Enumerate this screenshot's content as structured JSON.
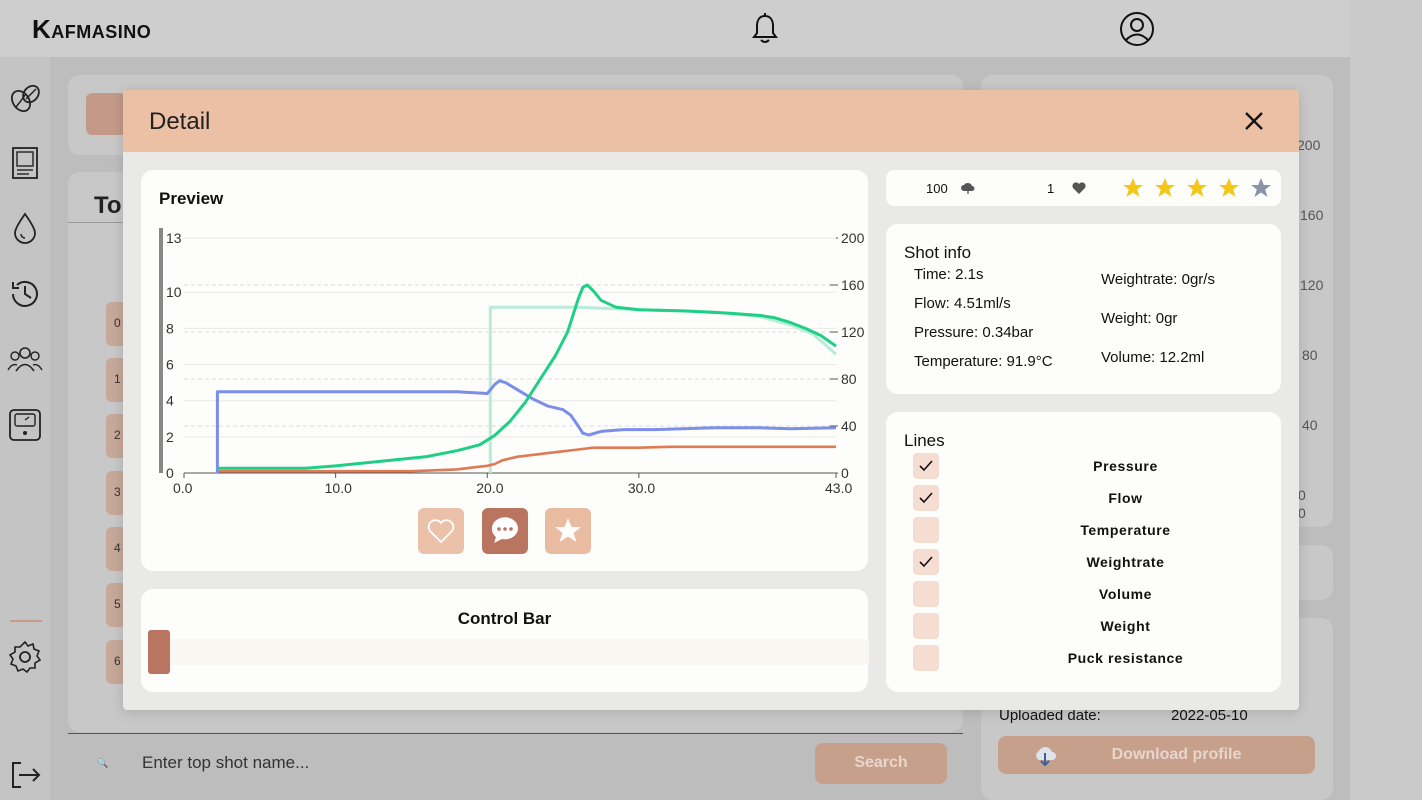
{
  "app": {
    "logo": "Kafmasino"
  },
  "background": {
    "tab_partial": "To",
    "row_numbers": [
      "0",
      "1",
      "2",
      "3",
      "4",
      "5",
      "6"
    ],
    "right_axis_partial": [
      "200",
      "160",
      "120",
      "80",
      "40",
      "0",
      "0"
    ],
    "search": {
      "placeholder": "Enter top shot name...",
      "button_label": "Search"
    },
    "uploaded_label": "Uploaded date:",
    "uploaded_value": "2022-05-10",
    "download_label": "Download profile"
  },
  "modal": {
    "title": "Detail",
    "preview_title": "Preview",
    "control_bar_title": "Control Bar",
    "control_bar": {
      "position_fraction": 0.0
    },
    "stats": {
      "downloads": "100",
      "likes": "1",
      "rating": 4,
      "rating_max": 5
    },
    "shot_info": {
      "title": "Shot info",
      "time": "Time: 2.1s",
      "flow": "Flow: 4.51ml/s",
      "pressure": "Pressure: 0.34bar",
      "temperature": "Temperature: 91.9°C",
      "weightrate": "Weightrate: 0gr/s",
      "weight": "Weight: 0gr",
      "volume": "Volume: 12.2ml"
    },
    "lines": {
      "title": "Lines",
      "items": [
        {
          "label": "Pressure",
          "checked": true
        },
        {
          "label": "Flow",
          "checked": true
        },
        {
          "label": "Temperature",
          "checked": false
        },
        {
          "label": "Weightrate",
          "checked": true
        },
        {
          "label": "Volume",
          "checked": false
        },
        {
          "label": "Weight",
          "checked": false
        },
        {
          "label": "Puck resistance",
          "checked": false
        }
      ]
    }
  },
  "colors": {
    "accent": "#ebc0a5",
    "button_dark": "#b97560",
    "button_light": "#e9bba0",
    "pressure": "#e07a55",
    "flow": "#7b8ee8",
    "weightrate": "#1fcf85",
    "target": "#b8ecd9",
    "star_on": "#f5c518",
    "star_off": "#8b93a6"
  },
  "chart_data": {
    "type": "line",
    "x_ticks": [
      "0.0",
      "10.0",
      "20.0",
      "30.0",
      "43.0"
    ],
    "y_left_ticks": [
      "0",
      "2",
      "4",
      "6",
      "8",
      "10",
      "13"
    ],
    "y_right_ticks": [
      "0",
      "40",
      "80",
      "120",
      "160",
      "200"
    ],
    "xlim": [
      0,
      43
    ],
    "ylim_left": [
      0,
      13
    ],
    "ylim_right": [
      0,
      200
    ],
    "grid": true,
    "series": [
      {
        "axis": "left",
        "points": [
          [
            2.2,
            0.1
          ],
          [
            5,
            0.1
          ],
          [
            10,
            0.1
          ],
          [
            15,
            0.1
          ],
          [
            18,
            0.2
          ],
          [
            19,
            0.3
          ],
          [
            20,
            0.4
          ],
          [
            20.5,
            0.5
          ],
          [
            21,
            0.7
          ],
          [
            22,
            0.9
          ],
          [
            23,
            1.0
          ],
          [
            24,
            1.1
          ],
          [
            25,
            1.2
          ],
          [
            26,
            1.3
          ],
          [
            27,
            1.4
          ],
          [
            28,
            1.4
          ],
          [
            30,
            1.4
          ],
          [
            32,
            1.45
          ],
          [
            35,
            1.45
          ],
          [
            38,
            1.45
          ],
          [
            40,
            1.45
          ],
          [
            43,
            1.45
          ]
        ]
      },
      {
        "axis": "left",
        "points": [
          [
            2.2,
            0.0
          ],
          [
            2.2,
            4.5
          ],
          [
            5,
            4.5
          ],
          [
            10,
            4.5
          ],
          [
            15,
            4.5
          ],
          [
            18,
            4.5
          ],
          [
            20,
            4.4
          ],
          [
            20.5,
            4.9
          ],
          [
            20.8,
            5.1
          ],
          [
            21.2,
            5.0
          ],
          [
            22,
            4.6
          ],
          [
            23,
            4.1
          ],
          [
            24,
            3.7
          ],
          [
            25,
            3.5
          ],
          [
            25.5,
            3.2
          ],
          [
            26,
            2.6
          ],
          [
            26.3,
            2.2
          ],
          [
            26.7,
            2.1
          ],
          [
            27.5,
            2.3
          ],
          [
            29,
            2.4
          ],
          [
            31,
            2.4
          ],
          [
            35,
            2.5
          ],
          [
            38,
            2.5
          ],
          [
            40,
            2.45
          ],
          [
            43,
            2.5
          ]
        ]
      },
      {
        "axis": "right",
        "points": [
          [
            2.2,
            4
          ],
          [
            5,
            4
          ],
          [
            8,
            4
          ],
          [
            10,
            6
          ],
          [
            13,
            10
          ],
          [
            16,
            14
          ],
          [
            18,
            19
          ],
          [
            19.5,
            24
          ],
          [
            20.5,
            32
          ],
          [
            21.5,
            44
          ],
          [
            22.5,
            60
          ],
          [
            23.5,
            80
          ],
          [
            24.5,
            100
          ],
          [
            25.3,
            120
          ],
          [
            26,
            148
          ],
          [
            26.3,
            158
          ],
          [
            26.6,
            160
          ],
          [
            27,
            155
          ],
          [
            27.5,
            147
          ],
          [
            28.5,
            141
          ],
          [
            30,
            139
          ],
          [
            33,
            138
          ],
          [
            36,
            136
          ],
          [
            38,
            134
          ],
          [
            39,
            132
          ],
          [
            40,
            128
          ],
          [
            41,
            123
          ],
          [
            42,
            117
          ],
          [
            43,
            108
          ]
        ]
      },
      {
        "axis": "right",
        "points": [
          [
            20.2,
            0
          ],
          [
            20.2,
            141
          ],
          [
            26,
            141
          ],
          [
            30,
            139
          ],
          [
            35,
            137
          ],
          [
            38,
            133
          ],
          [
            40,
            126
          ],
          [
            41.5,
            118
          ],
          [
            43,
            101
          ]
        ]
      }
    ]
  }
}
